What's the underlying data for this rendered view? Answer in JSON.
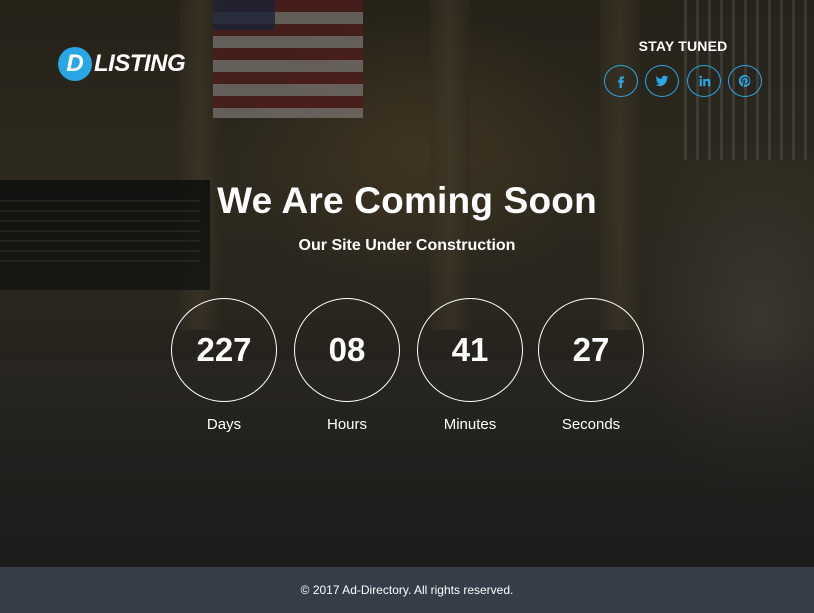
{
  "logo": {
    "badge_letter": "D",
    "text": "LISTING",
    "accent": "#29a6e5"
  },
  "stay_tuned": {
    "title": "STAY TUNED",
    "socials": [
      {
        "icon": "facebook-icon",
        "glyph": "f"
      },
      {
        "icon": "twitter-icon",
        "glyph": "t"
      },
      {
        "icon": "linkedin-icon",
        "glyph": "in"
      },
      {
        "icon": "pinterest-icon",
        "glyph": "p"
      }
    ]
  },
  "hero": {
    "title": "We Are Coming Soon",
    "subtitle": "Our Site Under Construction"
  },
  "countdown": [
    {
      "value": "227",
      "label": "Days"
    },
    {
      "value": "08",
      "label": "Hours"
    },
    {
      "value": "41",
      "label": "Minutes"
    },
    {
      "value": "27",
      "label": "Seconds"
    }
  ],
  "footer": {
    "text": "© 2017 Ad-Directory. All rights reserved."
  },
  "colors": {
    "accent": "#29a6e5",
    "footer_bg": "#353d48"
  }
}
